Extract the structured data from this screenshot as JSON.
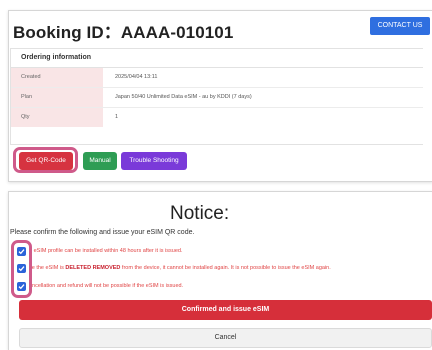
{
  "booking": {
    "title": "Booking ID：AAAA-010101",
    "contact_label": "CONTACT US"
  },
  "ordering": {
    "heading": "Ordering information",
    "rows": [
      {
        "label": "Created",
        "value": "2025/04/04 13:11"
      },
      {
        "label": "Plan",
        "value": "Japan 50/40 Unlimited Data eSIM - au by KDDI (7 days)"
      },
      {
        "label": "Qty",
        "value": "1"
      }
    ]
  },
  "actions": {
    "qr_label": "Get QR-Code",
    "manual_label": "Manual",
    "trouble_label": "Trouble Shooting"
  },
  "notice": {
    "title": "Notice:",
    "instruction": "Please confirm the following and issue your eSIM QR code.",
    "items": [
      {
        "pre": "e eSIM profile can be installed within 48 hours after it is issued.",
        "strong": "",
        "post": ""
      },
      {
        "pre": "ce the eSIM is ",
        "strong": "DELETED REMOVED",
        "post": " from the device, it cannot be installed again. It is not possible to issue the eSIM again."
      },
      {
        "pre": "ancellation and refund will not be possible if the eSIM is issued.",
        "strong": "",
        "post": ""
      }
    ],
    "confirm_label": "Confirmed and issue eSIM",
    "cancel_label": "Cancel"
  },
  "colors": {
    "highlight": "#cf5a8a",
    "checkbox": "#2b63d9",
    "danger": "#d62f3a"
  }
}
